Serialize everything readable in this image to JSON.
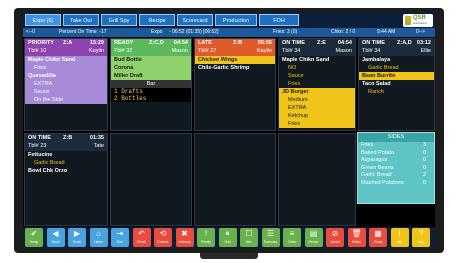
{
  "tabs": [
    {
      "label": "Expo (6)",
      "active": true
    },
    {
      "label": "Take Out",
      "active": false
    },
    {
      "label": "Grill Spy",
      "active": false
    },
    {
      "label": "Recipe",
      "active": false
    },
    {
      "label": "Scorecard",
      "active": false
    },
    {
      "label": "Production",
      "active": false
    },
    {
      "label": "FOH",
      "active": false
    }
  ],
  "logo": {
    "text": "QSR",
    "sub": "automations"
  },
  "status": {
    "arrows": "<--0",
    "percent": "Percent On Time: -17",
    "expo": "Expo",
    "times": "- 06:52  (01:35)  [06:52]",
    "fries": "Fries: 3  (0)",
    "chkn": "Chkn: 2 / 0",
    "clock": "9:44 AM",
    "right_arrow": "0-->"
  },
  "tickets": [
    {
      "name": "ticket-priority",
      "status": "PRIORITY",
      "mods": "Z:A",
      "time": "15:29",
      "table": "Tbl# 10",
      "server": "Kaylin",
      "header_color": "#8e44ad",
      "items": [
        {
          "text": "Maple Chikn Sand",
          "mod": false,
          "bg": "#a78bd8",
          "color": "#ffffff"
        },
        {
          "text": "Fries",
          "mod": true,
          "bg": "#a78bd8",
          "color": "#ffffff"
        },
        {
          "text": "Quesadilla",
          "mod": false,
          "bg": "#a78bd8",
          "color": "#ffffff"
        },
        {
          "text": "EXTRA",
          "mod": true,
          "bg": "#a78bd8",
          "color": "#ffffff"
        },
        {
          "text": "Sauce",
          "mod": true,
          "bg": "#a78bd8",
          "color": "#ffffff"
        },
        {
          "text": "On the Side",
          "mod": true,
          "bg": "#a78bd8",
          "color": "#ffffff"
        }
      ]
    },
    {
      "name": "ticket-ready",
      "status": "READY",
      "mods": "Z:C,D",
      "time": "04:54",
      "table": "Tbl# 32",
      "server": "Mason",
      "header_color": "#5cb85c",
      "items": [
        {
          "text": "Bud Bottle",
          "mod": false,
          "bg": "#8fd16a",
          "color": "#1a1a1a"
        },
        {
          "text": "Corona",
          "mod": false,
          "bg": "#8fd16a",
          "color": "#1a1a1a"
        },
        {
          "text": "Miller Draft",
          "mod": false,
          "bg": "#8fd16a",
          "color": "#1a1a1a"
        }
      ],
      "bar": {
        "title": "Bar",
        "lines": [
          "1 Drafts",
          "2 Bottles"
        ]
      }
    },
    {
      "name": "ticket-late",
      "status": "LATE",
      "mods": "Z:B",
      "time": "05:56",
      "table": "Tbl# 27",
      "server": "Kaylin",
      "header_color": "#e05b2b",
      "items": [
        {
          "text": "Chicken Wings",
          "mod": false,
          "bg": "#f0c419",
          "color": "#1a1a1a"
        },
        {
          "text": "Chile-Garlic Shrimp",
          "mod": false,
          "bg": "transparent",
          "color": "#ffffff"
        }
      ]
    },
    {
      "name": "ticket-on-time-1",
      "status": "ON TIME",
      "mods": "Z:E",
      "time": "04:54",
      "table": "Tbl# 34",
      "server": "Mason",
      "header_color": "#1c2b3c",
      "items": [
        {
          "text": "Maple Chikn Sand",
          "mod": false,
          "bg": "transparent",
          "color": "#ffffff"
        },
        {
          "text": "NO",
          "mod": true,
          "bg": "transparent",
          "color": "#f0c419"
        },
        {
          "text": "Sauce",
          "mod": true,
          "bg": "transparent",
          "color": "#f0c419"
        },
        {
          "text": "Fries",
          "mod": true,
          "bg": "transparent",
          "color": "#f0c419"
        },
        {
          "text": "JD Burger",
          "mod": false,
          "bg": "#f0c419",
          "color": "#1a1a1a"
        },
        {
          "text": "Medium",
          "mod": true,
          "bg": "#f0c419",
          "color": "#1a1a1a"
        },
        {
          "text": "EXTRA",
          "mod": true,
          "bg": "#f0c419",
          "color": "#1a1a1a"
        },
        {
          "text": "Ketchup",
          "mod": true,
          "bg": "#f0c419",
          "color": "#1a1a1a"
        },
        {
          "text": "Fries",
          "mod": true,
          "bg": "#f0c419",
          "color": "#1a1a1a"
        }
      ]
    },
    {
      "name": "ticket-on-time-2",
      "status": "ON TIME",
      "mods": "Z:A,D",
      "time": "03:12",
      "table": "Tbl# 34",
      "server": "Ellie",
      "header_color": "#1c2b3c",
      "items": [
        {
          "text": "Jambalaya",
          "mod": false,
          "bg": "transparent",
          "color": "#ffffff"
        },
        {
          "text": "Garlic Bread",
          "mod": true,
          "bg": "transparent",
          "color": "#f0c419"
        },
        {
          "text": "Bean Burrito",
          "mod": false,
          "bg": "#f0c419",
          "color": "#1a1a1a"
        },
        {
          "text": "Taco Salad",
          "mod": false,
          "bg": "transparent",
          "color": "#ffffff"
        },
        {
          "text": "Ranch",
          "mod": true,
          "bg": "transparent",
          "color": "#f0c419"
        }
      ]
    },
    {
      "name": "ticket-on-time-3",
      "status": "ON TIME",
      "mods": "Z:B",
      "time": "01:35",
      "table": "Tbl# 23",
      "server": "Tate",
      "header_color": "#1c2b3c",
      "items": [
        {
          "text": "Fettucine",
          "mod": false,
          "bg": "transparent",
          "color": "#ffffff"
        },
        {
          "text": "Garlic Bread",
          "mod": true,
          "bg": "transparent",
          "color": "#f0c419"
        },
        {
          "text": "Bowl Chk Orzo",
          "mod": false,
          "bg": "transparent",
          "color": "#ffffff"
        }
      ]
    }
  ],
  "sides": {
    "title": "SIDES",
    "items": [
      {
        "name": "Fries",
        "qty": "3"
      },
      {
        "name": "Baked Potato",
        "qty": "0"
      },
      {
        "name": "Asparagus",
        "qty": "0"
      },
      {
        "name": "Green Beans",
        "qty": "0"
      },
      {
        "name": "Garlic Bread",
        "qty": "2"
      },
      {
        "name": "Mashed Potatoes",
        "qty": "0"
      }
    ]
  },
  "toolbar": [
    {
      "label": "Bump",
      "icon": "✔",
      "color": "#6ab04c"
    },
    {
      "label": "Scroll",
      "icon": "◀",
      "color": "#4aa3df"
    },
    {
      "label": "Scroll",
      "icon": "▶",
      "color": "#4aa3df"
    },
    {
      "label": "Home",
      "icon": "⌂",
      "color": "#4aa3df"
    },
    {
      "label": "End",
      "icon": "⇥",
      "color": "#4aa3df"
    },
    {
      "label": "Recall",
      "icon": "↶",
      "color": "#e74c3c"
    },
    {
      "label": "Restore",
      "icon": "⟲",
      "color": "#e74c3c"
    },
    {
      "label": "Unbump",
      "icon": "✖",
      "color": "#e74c3c"
    },
    {
      "label": "Priority",
      "icon": "!",
      "color": "#6ab04c"
    },
    {
      "label": "Hold",
      "icon": "⏸",
      "color": "#6ab04c"
    },
    {
      "label": "Item",
      "icon": "☐",
      "color": "#6ab04c"
    },
    {
      "label": "Summary",
      "icon": "☰",
      "color": "#6ab04c"
    },
    {
      "label": "Sides",
      "icon": "≡",
      "color": "#6ab04c"
    },
    {
      "label": "Recipe",
      "icon": "▤",
      "color": "#6ab04c"
    },
    {
      "label": "Cancel",
      "icon": "⊘",
      "color": "#e74c3c"
    },
    {
      "label": "Delete",
      "icon": "🗑",
      "color": "#e74c3c"
    },
    {
      "label": "Group",
      "icon": "▦",
      "color": "#e74c3c"
    },
    {
      "label": "Info",
      "icon": "i",
      "color": "#f0c419"
    },
    {
      "label": "Help",
      "icon": "?",
      "color": "#f0c419"
    }
  ]
}
